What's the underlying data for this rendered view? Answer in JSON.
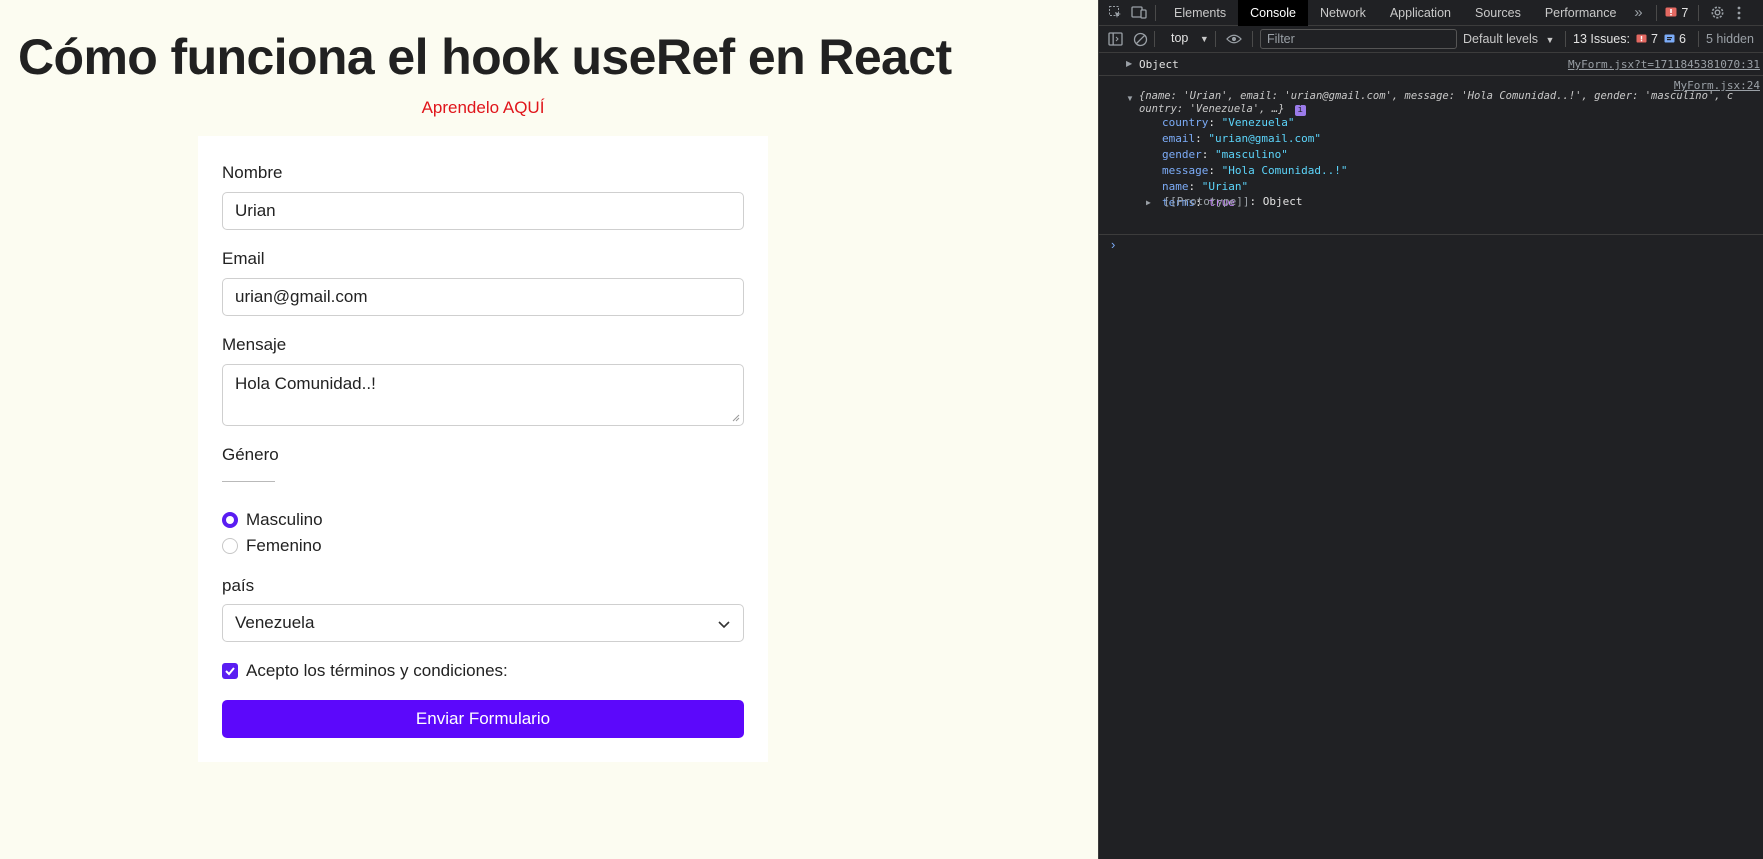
{
  "page": {
    "title": "Cómo funciona el hook useRef en React",
    "learn_link": "Aprendelo AQUÍ",
    "form": {
      "name_label": "Nombre",
      "name_value": "Urian",
      "email_label": "Email",
      "email_value": "urian@gmail.com",
      "message_label": "Mensaje",
      "message_value": "Hola Comunidad..!",
      "gender_label": "Género",
      "gender_options": [
        "Masculino",
        "Femenino"
      ],
      "country_label": "país",
      "country_value": "Venezuela",
      "terms_label": "Acepto los términos y condiciones:",
      "submit_label": "Enviar Formulario"
    }
  },
  "devtools": {
    "tabs": [
      "Elements",
      "Console",
      "Network",
      "Application",
      "Sources",
      "Performance"
    ],
    "error_count": "7",
    "context": "top",
    "filter_placeholder": "Filter",
    "levels": "Default levels",
    "issues_label": "13 Issues:",
    "issues_errors": "7",
    "issues_info": "6",
    "hidden_label": "5 hidden",
    "console": {
      "line1_label": "Object",
      "line1_source": "MyForm.jsx?t=1711845381070:31",
      "line2_source": "MyForm.jsx:24",
      "preview_part1": "{name: 'Urian', email: 'urian@gmail.com', message: 'Hola Comunidad..!', gender: 'masculino', c",
      "preview_part2": "ountry: 'Venezuela', …}",
      "props": [
        {
          "key": "country",
          "value": "\"Venezuela\"",
          "kind": "string"
        },
        {
          "key": "email",
          "value": "\"urian@gmail.com\"",
          "kind": "string"
        },
        {
          "key": "gender",
          "value": "\"masculino\"",
          "kind": "string"
        },
        {
          "key": "message",
          "value": "\"Hola Comunidad..!\"",
          "kind": "string"
        },
        {
          "key": "name",
          "value": "\"Urian\"",
          "kind": "string"
        },
        {
          "key": "terms",
          "value": "true",
          "kind": "bool"
        }
      ],
      "prototype_key": "[[Prototype]]",
      "prototype_value": "Object"
    }
  }
}
